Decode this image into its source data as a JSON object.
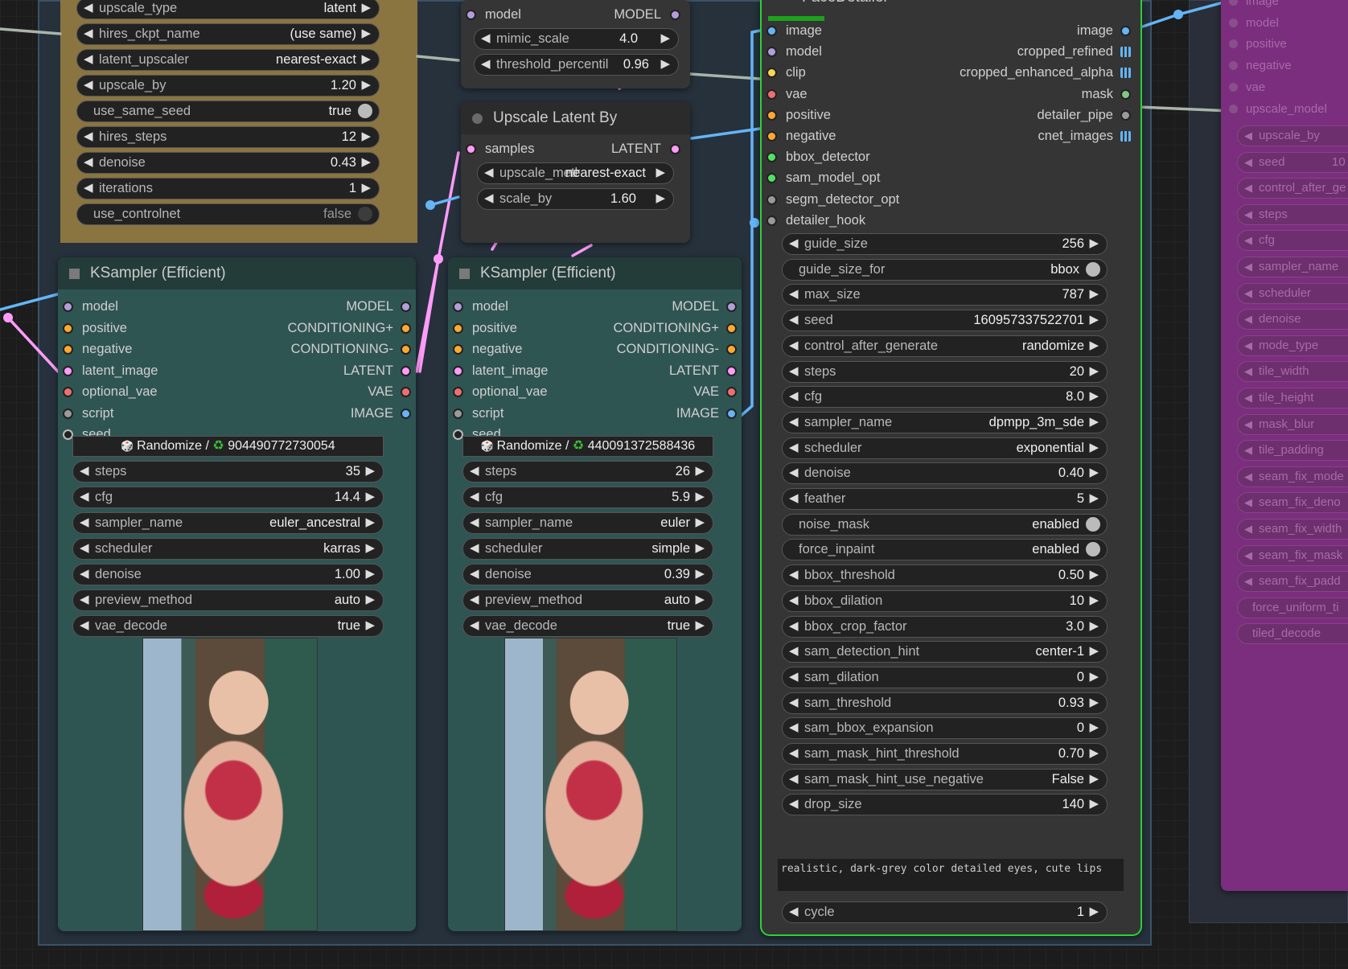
{
  "colors": {
    "model": "#b39ddb",
    "clip": "#ffd54f",
    "vae": "#ef6f6f",
    "conditioning": "#ffa931",
    "latent": "#ff9cf9",
    "image": "#64b5f6",
    "mask": "#81c784",
    "detector": "#50e35e",
    "pipe": "#9a9a9a",
    "seed": "#222222",
    "teal_node": "#2f5553",
    "teal_title": "#233c3a",
    "dark_node": "#353535",
    "brown_group": "#8a7440",
    "purple_node": "#7b2e7e"
  },
  "hires_node": {
    "widgets": [
      {
        "name": "upscale_type",
        "value": "latent"
      },
      {
        "name": "hires_ckpt_name",
        "value": "(use same)"
      },
      {
        "name": "latent_upscaler",
        "value": "nearest-exact"
      },
      {
        "name": "upscale_by",
        "value": "1.20"
      }
    ],
    "toggle_seed": {
      "name": "use_same_seed",
      "value": "true"
    },
    "widgets2": [
      {
        "name": "hires_steps",
        "value": "12"
      },
      {
        "name": "denoise",
        "value": "0.43"
      },
      {
        "name": "iterations",
        "value": "1"
      }
    ],
    "toggle_cn": {
      "name": "use_controlnet",
      "value": "false"
    }
  },
  "top_node": {
    "inputs": [
      {
        "name": "model",
        "type": "MODEL"
      }
    ],
    "widgets": [
      {
        "name": "mimic_scale",
        "value": "4.0"
      },
      {
        "name": "threshold_percentile",
        "value": "0.96"
      }
    ]
  },
  "upscale_latent": {
    "title": "Upscale Latent By",
    "inputs": [
      {
        "name": "samples",
        "type": "LATENT"
      }
    ],
    "widgets": [
      {
        "name": "upscale_method",
        "value": "nearest-exact"
      },
      {
        "name": "scale_by",
        "value": "1.60"
      }
    ]
  },
  "ksampler1": {
    "title": "KSampler (Efficient)",
    "inputs": [
      "model",
      "positive",
      "negative",
      "latent_image",
      "optional_vae",
      "script",
      "seed"
    ],
    "outputs": [
      "MODEL",
      "CONDITIONING+",
      "CONDITIONING-",
      "LATENT",
      "VAE",
      "IMAGE"
    ],
    "seed_mode": "Randomize /",
    "seed_value": "904490772730054",
    "widgets": [
      {
        "name": "steps",
        "value": "35"
      },
      {
        "name": "cfg",
        "value": "14.4"
      },
      {
        "name": "sampler_name",
        "value": "euler_ancestral"
      },
      {
        "name": "scheduler",
        "value": "karras"
      },
      {
        "name": "denoise",
        "value": "1.00"
      },
      {
        "name": "preview_method",
        "value": "auto"
      },
      {
        "name": "vae_decode",
        "value": "true"
      }
    ]
  },
  "ksampler2": {
    "title": "KSampler (Efficient)",
    "inputs": [
      "model",
      "positive",
      "negative",
      "latent_image",
      "optional_vae",
      "script",
      "seed"
    ],
    "outputs": [
      "MODEL",
      "CONDITIONING+",
      "CONDITIONING-",
      "LATENT",
      "VAE",
      "IMAGE"
    ],
    "seed_mode": "Randomize /",
    "seed_value": "440091372588436",
    "widgets": [
      {
        "name": "steps",
        "value": "26"
      },
      {
        "name": "cfg",
        "value": "5.9"
      },
      {
        "name": "sampler_name",
        "value": "euler"
      },
      {
        "name": "scheduler",
        "value": "simple"
      },
      {
        "name": "denoise",
        "value": "0.39"
      },
      {
        "name": "preview_method",
        "value": "auto"
      },
      {
        "name": "vae_decode",
        "value": "true"
      }
    ]
  },
  "facedetailer": {
    "title": "FaceDetailer",
    "inputs": [
      "image",
      "model",
      "clip",
      "vae",
      "positive",
      "negative",
      "bbox_detector",
      "sam_model_opt",
      "segm_detector_opt",
      "detailer_hook"
    ],
    "outputs": [
      "image",
      "cropped_refined",
      "cropped_enhanced_alpha",
      "mask",
      "detailer_pipe",
      "cnet_images"
    ],
    "widgets": [
      {
        "name": "guide_size",
        "value": "256"
      },
      {
        "name": "guide_size_for",
        "value": "bbox",
        "toggle": true
      },
      {
        "name": "max_size",
        "value": "787"
      },
      {
        "name": "seed",
        "value": "160957337522701"
      },
      {
        "name": "control_after_generate",
        "value": "randomize"
      },
      {
        "name": "steps",
        "value": "20"
      },
      {
        "name": "cfg",
        "value": "8.0"
      },
      {
        "name": "sampler_name",
        "value": "dpmpp_3m_sde"
      },
      {
        "name": "scheduler",
        "value": "exponential"
      },
      {
        "name": "denoise",
        "value": "0.40"
      },
      {
        "name": "feather",
        "value": "5"
      },
      {
        "name": "noise_mask",
        "value": "enabled",
        "toggle": true
      },
      {
        "name": "force_inpaint",
        "value": "enabled",
        "toggle": true
      },
      {
        "name": "bbox_threshold",
        "value": "0.50"
      },
      {
        "name": "bbox_dilation",
        "value": "10"
      },
      {
        "name": "bbox_crop_factor",
        "value": "3.0"
      },
      {
        "name": "sam_detection_hint",
        "value": "center-1"
      },
      {
        "name": "sam_dilation",
        "value": "0"
      },
      {
        "name": "sam_threshold",
        "value": "0.93"
      },
      {
        "name": "sam_bbox_expansion",
        "value": "0"
      },
      {
        "name": "sam_mask_hint_threshold",
        "value": "0.70"
      },
      {
        "name": "sam_mask_hint_use_negative",
        "value": "False"
      },
      {
        "name": "drop_size",
        "value": "140"
      }
    ],
    "wildcard": "realistic, dark-grey color detailed eyes, cute lips",
    "cycle": {
      "name": "cycle",
      "value": "1"
    }
  },
  "purple_node": {
    "inputs": [
      "image",
      "model",
      "positive",
      "negative",
      "vae",
      "upscale_model"
    ],
    "widgets": [
      "upscale_by",
      "seed",
      "control_after_ge",
      "steps",
      "cfg",
      "sampler_name",
      "scheduler",
      "denoise",
      "mode_type",
      "tile_width",
      "tile_height",
      "mask_blur",
      "tile_padding",
      "seam_fix_mode",
      "seam_fix_deno",
      "seam_fix_width",
      "seam_fix_mask",
      "seam_fix_padd",
      "force_uniform_ti",
      "tiled_decode"
    ],
    "seed_value_partial": "10"
  }
}
